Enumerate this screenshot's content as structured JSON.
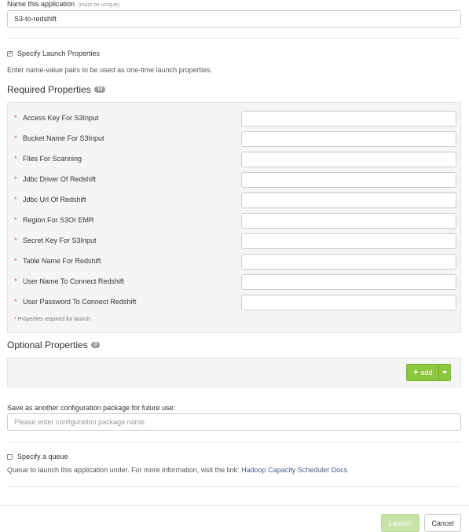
{
  "app_name": {
    "label": "Name this application",
    "hint": "(must be unique)",
    "value": "S3-to-redshift"
  },
  "launch_props": {
    "checkbox_label": "Specify Launch Properties",
    "checked": true,
    "check_mark": "✓",
    "description": "Enter name-value pairs to be used as one-time launch properties."
  },
  "required": {
    "title": "Required Properties",
    "count": "10",
    "marker": "*",
    "items": [
      {
        "label": "Access Key For S3Input"
      },
      {
        "label": "Bucket Name For S3Input"
      },
      {
        "label": "Files For Scanning"
      },
      {
        "label": "Jdbc Driver Of Redshift"
      },
      {
        "label": "Jdbc Url Of Redshift"
      },
      {
        "label": "Region For S3Or EMR"
      },
      {
        "label": "Secret Key For S3Input"
      },
      {
        "label": "Table Name For Redshift"
      },
      {
        "label": "User Name To Connect Redshift"
      },
      {
        "label": "User Password To Connect Redshift"
      }
    ],
    "note": "Properties required for launch."
  },
  "optional": {
    "title": "Optional Properties",
    "count": "0",
    "add_label": "add",
    "add_icon": "+"
  },
  "config_package": {
    "label": "Save as another configuration package for future use:",
    "placeholder": "Please enter configuration package name.",
    "value": ""
  },
  "queue": {
    "checkbox_label": "Specify a queue",
    "checked": false,
    "info_text": "Queue to launch this application under. For more information, visit the link: ",
    "link_text": "Hadoop Capacity Scheduler Docs"
  },
  "footer": {
    "launch_label": "Launch",
    "cancel_label": "Cancel"
  },
  "colors": {
    "accent_green": "#8dc63f",
    "required_star": "#d9534f",
    "badge_gray": "#999999",
    "link": "#4a5a8a"
  }
}
